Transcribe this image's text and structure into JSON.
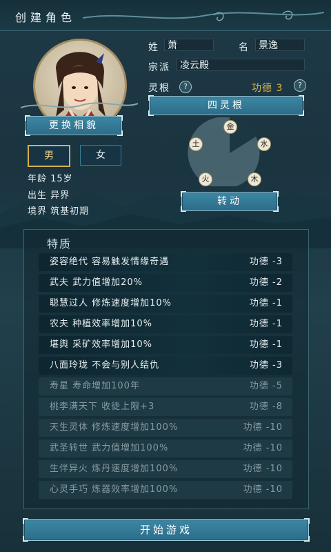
{
  "header": {
    "title": "创建角色"
  },
  "avatar": {
    "button_label": "更换相貌"
  },
  "gender": {
    "male": "男",
    "female": "女",
    "selected": "male"
  },
  "profile": {
    "age": "年龄 15岁",
    "birth": "出生 异界",
    "realm": "境界 筑基初期"
  },
  "name": {
    "surname_label": "姓",
    "surname": "萧",
    "given_label": "名",
    "given": "景逸"
  },
  "sect": {
    "label": "宗派",
    "value": "凌云殿"
  },
  "root": {
    "label": "灵根",
    "help": "?",
    "merit": "功德 3",
    "root_button": "四灵根",
    "spin_button": "转动"
  },
  "elements": [
    "金",
    "水",
    "木",
    "火",
    "土"
  ],
  "traits": {
    "title": "特质",
    "items": [
      {
        "text": "姿容绝代  容易触发情缘奇遇",
        "merit": "功德 -3",
        "active": true
      },
      {
        "text": "武夫  武力值增加20%",
        "merit": "功德 -2",
        "active": true
      },
      {
        "text": "聪慧过人  修炼速度增加10%",
        "merit": "功德 -1",
        "active": true
      },
      {
        "text": "农夫  种植效率增加10%",
        "merit": "功德 -1",
        "active": true
      },
      {
        "text": "堪舆  采矿效率增加10%",
        "merit": "功德 -1",
        "active": true
      },
      {
        "text": "八面玲珑  不会与别人结仇",
        "merit": "功德 -3",
        "active": true
      },
      {
        "text": "寿星  寿命增加100年",
        "merit": "功德 -5",
        "active": false
      },
      {
        "text": "桃李满天下  收徒上限+3",
        "merit": "功德 -8",
        "active": false
      },
      {
        "text": "天生灵体  修炼速度增加100%",
        "merit": "功德 -10",
        "active": false
      },
      {
        "text": "武圣转世  武力值增加100%",
        "merit": "功德 -10",
        "active": false
      },
      {
        "text": "生伴异火  炼丹速度增加100%",
        "merit": "功德 -10",
        "active": false
      },
      {
        "text": "心灵手巧  炼器效率增加100%",
        "merit": "功德 -10",
        "active": false
      }
    ]
  },
  "start_button": "开始游戏",
  "colors": {
    "accent": "#3d87a4",
    "gold": "#e0b54a",
    "background": "#1e3a46"
  }
}
